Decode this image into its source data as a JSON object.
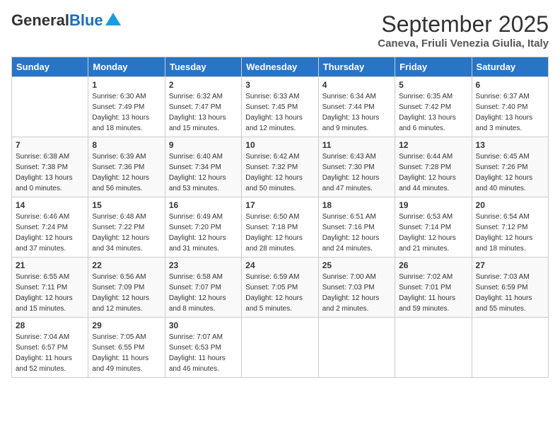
{
  "header": {
    "logo_general": "General",
    "logo_blue": "Blue",
    "title": "September 2025",
    "location": "Caneva, Friuli Venezia Giulia, Italy"
  },
  "days_of_week": [
    "Sunday",
    "Monday",
    "Tuesday",
    "Wednesday",
    "Thursday",
    "Friday",
    "Saturday"
  ],
  "weeks": [
    [
      {
        "day": "",
        "sunrise": "",
        "sunset": "",
        "daylight": ""
      },
      {
        "day": "1",
        "sunrise": "Sunrise: 6:30 AM",
        "sunset": "Sunset: 7:49 PM",
        "daylight": "Daylight: 13 hours and 18 minutes."
      },
      {
        "day": "2",
        "sunrise": "Sunrise: 6:32 AM",
        "sunset": "Sunset: 7:47 PM",
        "daylight": "Daylight: 13 hours and 15 minutes."
      },
      {
        "day": "3",
        "sunrise": "Sunrise: 6:33 AM",
        "sunset": "Sunset: 7:45 PM",
        "daylight": "Daylight: 13 hours and 12 minutes."
      },
      {
        "day": "4",
        "sunrise": "Sunrise: 6:34 AM",
        "sunset": "Sunset: 7:44 PM",
        "daylight": "Daylight: 13 hours and 9 minutes."
      },
      {
        "day": "5",
        "sunrise": "Sunrise: 6:35 AM",
        "sunset": "Sunset: 7:42 PM",
        "daylight": "Daylight: 13 hours and 6 minutes."
      },
      {
        "day": "6",
        "sunrise": "Sunrise: 6:37 AM",
        "sunset": "Sunset: 7:40 PM",
        "daylight": "Daylight: 13 hours and 3 minutes."
      }
    ],
    [
      {
        "day": "7",
        "sunrise": "Sunrise: 6:38 AM",
        "sunset": "Sunset: 7:38 PM",
        "daylight": "Daylight: 13 hours and 0 minutes."
      },
      {
        "day": "8",
        "sunrise": "Sunrise: 6:39 AM",
        "sunset": "Sunset: 7:36 PM",
        "daylight": "Daylight: 12 hours and 56 minutes."
      },
      {
        "day": "9",
        "sunrise": "Sunrise: 6:40 AM",
        "sunset": "Sunset: 7:34 PM",
        "daylight": "Daylight: 12 hours and 53 minutes."
      },
      {
        "day": "10",
        "sunrise": "Sunrise: 6:42 AM",
        "sunset": "Sunset: 7:32 PM",
        "daylight": "Daylight: 12 hours and 50 minutes."
      },
      {
        "day": "11",
        "sunrise": "Sunrise: 6:43 AM",
        "sunset": "Sunset: 7:30 PM",
        "daylight": "Daylight: 12 hours and 47 minutes."
      },
      {
        "day": "12",
        "sunrise": "Sunrise: 6:44 AM",
        "sunset": "Sunset: 7:28 PM",
        "daylight": "Daylight: 12 hours and 44 minutes."
      },
      {
        "day": "13",
        "sunrise": "Sunrise: 6:45 AM",
        "sunset": "Sunset: 7:26 PM",
        "daylight": "Daylight: 12 hours and 40 minutes."
      }
    ],
    [
      {
        "day": "14",
        "sunrise": "Sunrise: 6:46 AM",
        "sunset": "Sunset: 7:24 PM",
        "daylight": "Daylight: 12 hours and 37 minutes."
      },
      {
        "day": "15",
        "sunrise": "Sunrise: 6:48 AM",
        "sunset": "Sunset: 7:22 PM",
        "daylight": "Daylight: 12 hours and 34 minutes."
      },
      {
        "day": "16",
        "sunrise": "Sunrise: 6:49 AM",
        "sunset": "Sunset: 7:20 PM",
        "daylight": "Daylight: 12 hours and 31 minutes."
      },
      {
        "day": "17",
        "sunrise": "Sunrise: 6:50 AM",
        "sunset": "Sunset: 7:18 PM",
        "daylight": "Daylight: 12 hours and 28 minutes."
      },
      {
        "day": "18",
        "sunrise": "Sunrise: 6:51 AM",
        "sunset": "Sunset: 7:16 PM",
        "daylight": "Daylight: 12 hours and 24 minutes."
      },
      {
        "day": "19",
        "sunrise": "Sunrise: 6:53 AM",
        "sunset": "Sunset: 7:14 PM",
        "daylight": "Daylight: 12 hours and 21 minutes."
      },
      {
        "day": "20",
        "sunrise": "Sunrise: 6:54 AM",
        "sunset": "Sunset: 7:12 PM",
        "daylight": "Daylight: 12 hours and 18 minutes."
      }
    ],
    [
      {
        "day": "21",
        "sunrise": "Sunrise: 6:55 AM",
        "sunset": "Sunset: 7:11 PM",
        "daylight": "Daylight: 12 hours and 15 minutes."
      },
      {
        "day": "22",
        "sunrise": "Sunrise: 6:56 AM",
        "sunset": "Sunset: 7:09 PM",
        "daylight": "Daylight: 12 hours and 12 minutes."
      },
      {
        "day": "23",
        "sunrise": "Sunrise: 6:58 AM",
        "sunset": "Sunset: 7:07 PM",
        "daylight": "Daylight: 12 hours and 8 minutes."
      },
      {
        "day": "24",
        "sunrise": "Sunrise: 6:59 AM",
        "sunset": "Sunset: 7:05 PM",
        "daylight": "Daylight: 12 hours and 5 minutes."
      },
      {
        "day": "25",
        "sunrise": "Sunrise: 7:00 AM",
        "sunset": "Sunset: 7:03 PM",
        "daylight": "Daylight: 12 hours and 2 minutes."
      },
      {
        "day": "26",
        "sunrise": "Sunrise: 7:02 AM",
        "sunset": "Sunset: 7:01 PM",
        "daylight": "Daylight: 11 hours and 59 minutes."
      },
      {
        "day": "27",
        "sunrise": "Sunrise: 7:03 AM",
        "sunset": "Sunset: 6:59 PM",
        "daylight": "Daylight: 11 hours and 55 minutes."
      }
    ],
    [
      {
        "day": "28",
        "sunrise": "Sunrise: 7:04 AM",
        "sunset": "Sunset: 6:57 PM",
        "daylight": "Daylight: 11 hours and 52 minutes."
      },
      {
        "day": "29",
        "sunrise": "Sunrise: 7:05 AM",
        "sunset": "Sunset: 6:55 PM",
        "daylight": "Daylight: 11 hours and 49 minutes."
      },
      {
        "day": "30",
        "sunrise": "Sunrise: 7:07 AM",
        "sunset": "Sunset: 6:53 PM",
        "daylight": "Daylight: 11 hours and 46 minutes."
      },
      {
        "day": "",
        "sunrise": "",
        "sunset": "",
        "daylight": ""
      },
      {
        "day": "",
        "sunrise": "",
        "sunset": "",
        "daylight": ""
      },
      {
        "day": "",
        "sunrise": "",
        "sunset": "",
        "daylight": ""
      },
      {
        "day": "",
        "sunrise": "",
        "sunset": "",
        "daylight": ""
      }
    ]
  ]
}
